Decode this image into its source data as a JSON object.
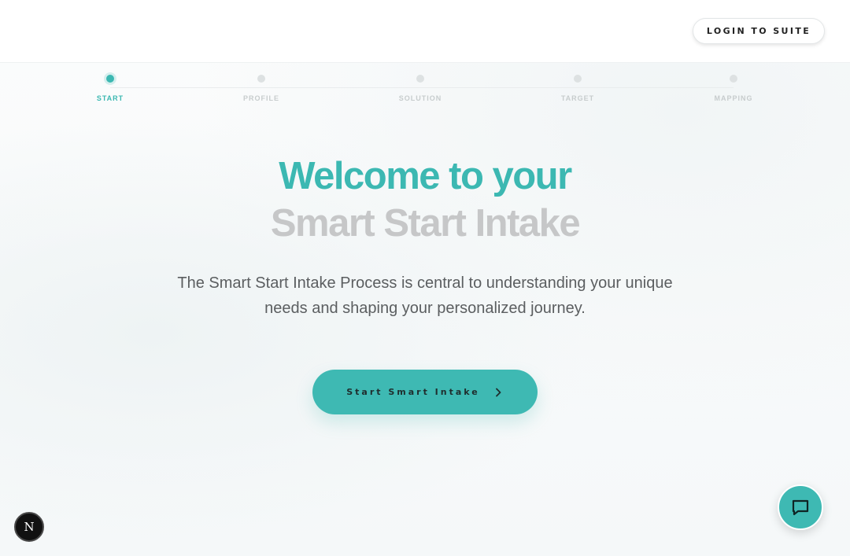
{
  "header": {
    "login_label": "LOGIN TO SUITE"
  },
  "stepper": {
    "steps": [
      {
        "label": "START",
        "active": true
      },
      {
        "label": "PROFILE",
        "active": false
      },
      {
        "label": "SOLUTION",
        "active": false
      },
      {
        "label": "TARGET",
        "active": false
      },
      {
        "label": "MAPPING",
        "active": false
      }
    ]
  },
  "hero": {
    "title_line1": "Welcome to your",
    "title_line2": "Smart Start Intake",
    "description": "The Smart Start Intake Process is central to understanding your unique needs and shaping your personalized journey.",
    "cta_label": "Start Smart Intake",
    "cta_icon": "chevron-right-icon"
  },
  "widgets": {
    "chat_icon": "chat-icon",
    "badge_letter": "N"
  },
  "colors": {
    "accent": "#3cb8b2",
    "title_secondary": "#c6c7c8",
    "text": "#5b5e60"
  }
}
